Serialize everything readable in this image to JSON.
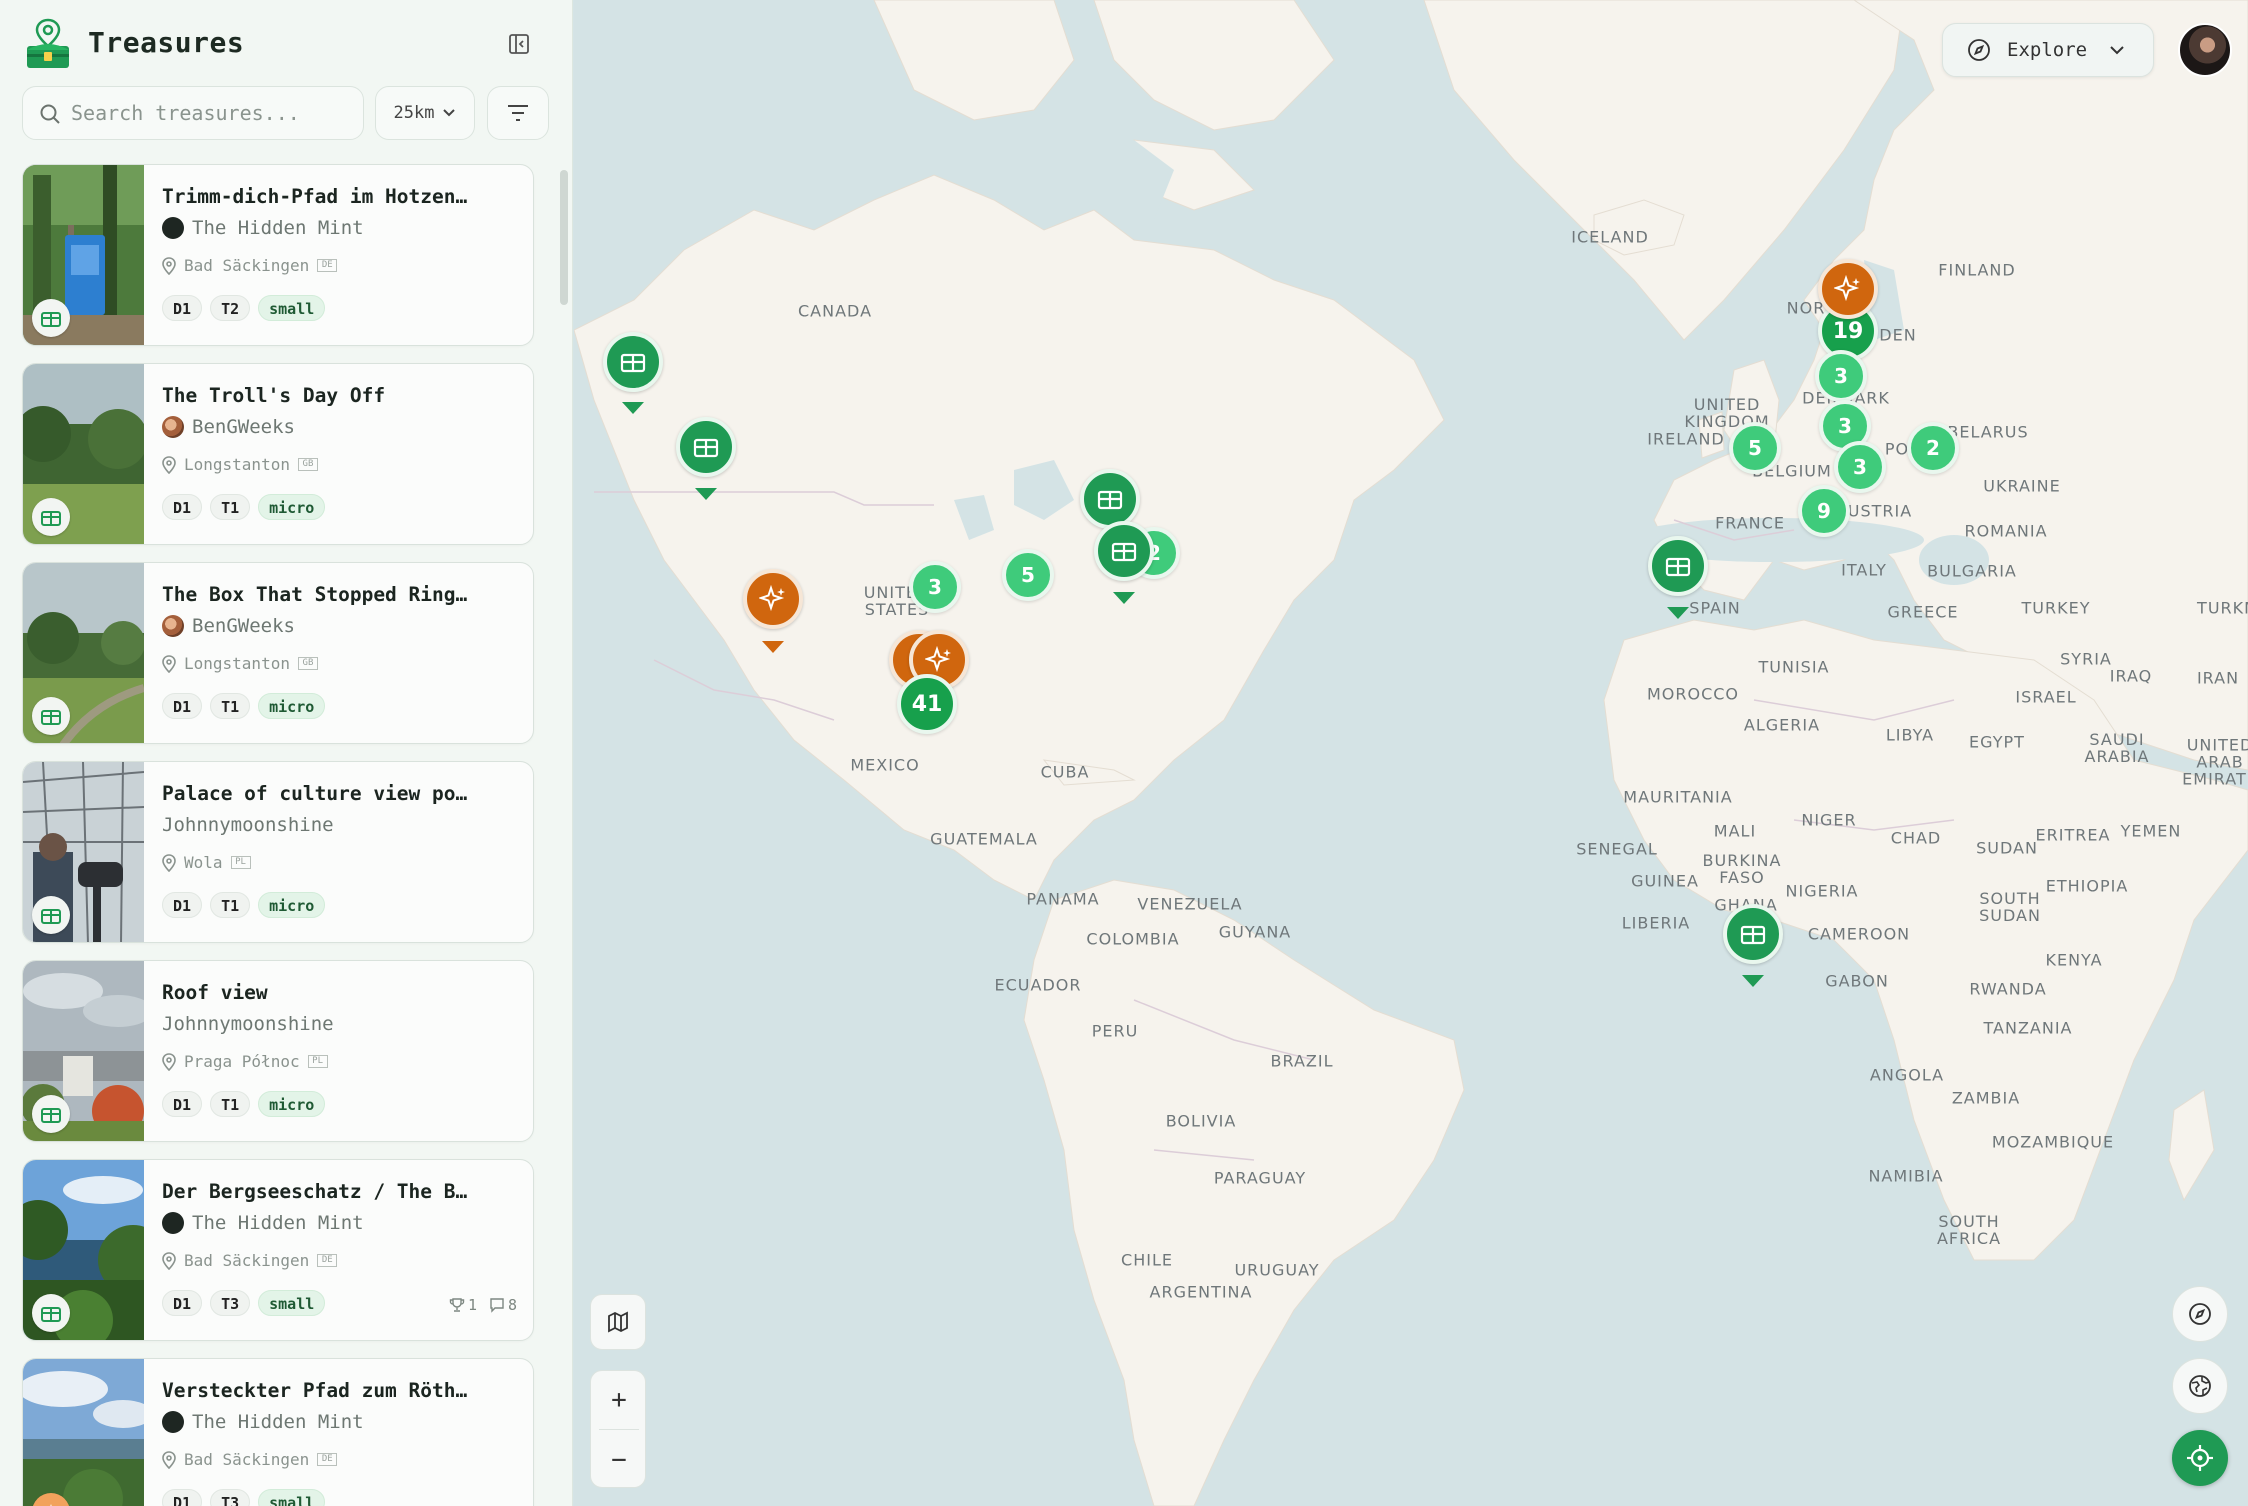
{
  "app": {
    "title": "Treasures"
  },
  "search": {
    "placeholder": "Search treasures..."
  },
  "radius": {
    "value": "25km"
  },
  "icons": {
    "logo": "treasure-chest-pin-icon",
    "collapse": "sidebar-collapse-icon",
    "search": "search-icon",
    "filter": "filter-lines-icon",
    "pin": "map-pin-icon",
    "chest": "treasure-chest-icon",
    "sparkle": "sparkle-icon",
    "trophy": "trophy-icon",
    "comment": "comment-icon",
    "compass": "compass-icon",
    "map": "map-icon",
    "globe": "globe-icon",
    "locate": "crosshair-icon"
  },
  "colors": {
    "accent": "#1f9a54",
    "cluster": "#3fcb7b",
    "cluster_dark": "#17a04c",
    "special": "#d0660e",
    "sidebar_bg": "#f2f7f3",
    "map_water": "#d4e3e5",
    "map_land": "#f5f2ec"
  },
  "treasures": [
    {
      "title": "Trimm-dich-Pfad im Hotzen…",
      "owner": "The Hidden Mint",
      "location": "Bad Säckingen",
      "flag": "DE",
      "difficulty": "D1",
      "terrain": "T2",
      "size": "small"
    },
    {
      "title": "The Troll's Day Off",
      "owner": "BenGWeeks",
      "location": "Longstanton",
      "flag": "GB",
      "difficulty": "D1",
      "terrain": "T1",
      "size": "micro"
    },
    {
      "title": "The Box That Stopped Ring…",
      "owner": "BenGWeeks",
      "location": "Longstanton",
      "flag": "GB",
      "difficulty": "D1",
      "terrain": "T1",
      "size": "micro"
    },
    {
      "title": "Palace of culture view po…",
      "owner": "Johnnymoonshine",
      "location": "Wola",
      "flag": "PL",
      "difficulty": "D1",
      "terrain": "T1",
      "size": "micro"
    },
    {
      "title": "Roof view",
      "owner": "Johnnymoonshine",
      "location": "Praga Północ",
      "flag": "PL",
      "difficulty": "D1",
      "terrain": "T1",
      "size": "micro"
    },
    {
      "title": "Der Bergseeschatz / The B…",
      "owner": "The Hidden Mint",
      "location": "Bad Säckingen",
      "flag": "DE",
      "difficulty": "D1",
      "terrain": "T3",
      "size": "small",
      "finds": "1",
      "comments": "8"
    },
    {
      "title": "Versteckter Pfad zum Röth…",
      "owner": "The Hidden Mint",
      "location": "Bad Säckingen",
      "flag": "DE",
      "difficulty": "D1",
      "terrain": "T3",
      "size": "small"
    }
  ],
  "map": {
    "labels": {
      "canada": "CANADA",
      "iceland": "ICELAND",
      "finland": "FINLAND",
      "norway": "NOR",
      "sweden": "DEN",
      "uk": "UNITED\nKINGDOM",
      "ireland": "IRELAND",
      "denmark": "DENMARK",
      "belarus": "BELARUS",
      "poland": "PO",
      "belgium": "BELGIUM",
      "ukraine": "UKRAINE",
      "france": "FRANCE",
      "austria": "AUSTRIA",
      "romania": "ROMANIA",
      "italy": "ITALY",
      "bulgaria": "BULGARIA",
      "spain": "SPAIN",
      "greece": "GREECE",
      "turkey": "TURKEY",
      "turkmen": "TURKM",
      "tunisia": "TUNISIA",
      "syria": "SYRIA",
      "iraq": "IRAQ",
      "iran": "IRAN",
      "morocco": "MOROCCO",
      "israel": "ISRAEL",
      "algeria": "ALGERIA",
      "libya": "LIBYA",
      "egypt": "EGYPT",
      "saudi": "SAUDI\nARABIA",
      "uae": "UNITED\nARAB\nEMIRATE",
      "mauritania": "MAURITANIA",
      "mali": "MALI",
      "niger": "NIGER",
      "chad": "CHAD",
      "sudan": "SUDAN",
      "eritrea": "ERITREA",
      "yemen": "YEMEN",
      "senegal": "SENEGAL",
      "burkina": "BURKINA\nFASO",
      "guinea": "GUINEA",
      "nigeria": "NIGERIA",
      "ethiopia": "ETHIOPIA",
      "south_sudan": "SOUTH\nSUDAN",
      "liberia": "LIBERIA",
      "ghana": "GHANA",
      "cameroon": "CAMEROON",
      "kenya": "KENYA",
      "gabon": "GABON",
      "rwanda": "RWANDA",
      "tanzania": "TANZANIA",
      "angola": "ANGOLA",
      "zambia": "ZAMBIA",
      "mozambique": "MOZAMBIQUE",
      "namibia": "NAMIBIA",
      "south_africa": "SOUTH\nAFRICA",
      "usa": "UNITED\nSTATES",
      "mexico": "MEXICO",
      "cuba": "CUBA",
      "guatemala": "GUATEMALA",
      "panama": "PANAMA",
      "venezuela": "VENEZUELA",
      "guyana": "GUYANA",
      "colombia": "COLOMBIA",
      "ecuador": "ECUADOR",
      "peru": "PERU",
      "brazil": "BRAZIL",
      "bolivia": "BOLIVIA",
      "paraguay": "PARAGUAY",
      "chile": "CHILE",
      "uruguay": "URUGUAY",
      "argentina": "ARGENTINA"
    },
    "clusters": {
      "c1": "3",
      "c2": "5",
      "c3": "2",
      "c4": "41",
      "c5": "19",
      "c6": "3",
      "c7": "3",
      "c8": "5",
      "c9": "3",
      "c10": "2",
      "c11": "9"
    }
  },
  "explore": {
    "label": "Explore"
  },
  "zoom": {
    "in": "+",
    "out": "−"
  }
}
